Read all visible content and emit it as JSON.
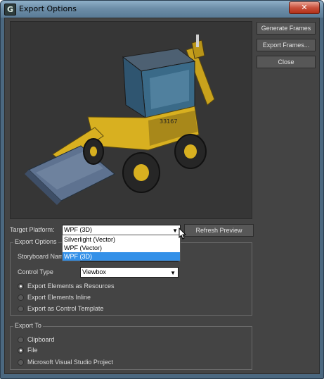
{
  "window": {
    "title": "Export Options",
    "close_glyph": "✕",
    "app_icon": "G"
  },
  "side_buttons": {
    "generate_frames": "Generate Frames",
    "export_frames": "Export Frames...",
    "close": "Close"
  },
  "target_platform": {
    "label": "Target Platform:",
    "selected": "WPF (3D)",
    "options": [
      "Silverlight (Vector)",
      "WPF (Vector)",
      "WPF (3D)"
    ],
    "refresh_button": "Refresh Preview"
  },
  "export_options": {
    "group_title": "Export Options",
    "storyboard_label": "Storyboard Name",
    "storyboard_value": "",
    "control_type_label": "Control Type",
    "control_type_value": "Viewbox",
    "radios": [
      {
        "label": "Export Elements as Resources",
        "checked": true
      },
      {
        "label": "Export Elements Inline",
        "checked": false
      },
      {
        "label": "Export as Control Template",
        "checked": false
      }
    ]
  },
  "export_to": {
    "group_title": "Export To",
    "radios": [
      {
        "label": "Clipboard",
        "checked": false
      },
      {
        "label": "File",
        "checked": true
      },
      {
        "label": "Microsoft Visual Studio Project",
        "checked": false
      }
    ]
  },
  "icons": {
    "app": "app-icon",
    "close": "close-icon",
    "dropdown_arrow": "chevron-down-icon",
    "cursor": "mouse-pointer-icon"
  },
  "colors": {
    "title_bar": "#6d8ea8",
    "client_bg": "#444444",
    "viewport_bg": "#363636",
    "selection": "#3390e8",
    "model_yellow": "#d8b020"
  }
}
